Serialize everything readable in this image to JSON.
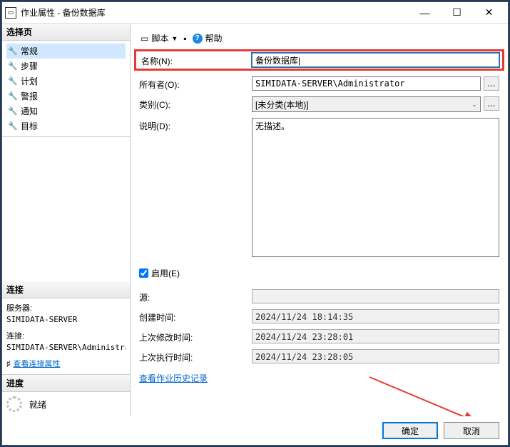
{
  "window": {
    "title": "作业属性 - 备份数据库"
  },
  "sidebar": {
    "select_header": "选择页",
    "items": [
      {
        "label": "常规"
      },
      {
        "label": "步骤"
      },
      {
        "label": "计划"
      },
      {
        "label": "警报"
      },
      {
        "label": "通知"
      },
      {
        "label": "目标"
      }
    ],
    "connection_header": "连接",
    "server_label": "服务器:",
    "server_value": "SIMIDATA-SERVER",
    "conn_label": "连接:",
    "conn_value": "SIMIDATA-SERVER\\Administrat",
    "view_conn_link": "查看连接属性",
    "progress_header": "进度",
    "progress_status": "就绪"
  },
  "toolbar": {
    "script_label": "脚本",
    "help_label": "帮助"
  },
  "form": {
    "name_label": "名称(N):",
    "name_value": "备份数据库|",
    "owner_label": "所有者(O):",
    "owner_value": "SIMIDATA-SERVER\\Administrator",
    "category_label": "类别(C):",
    "category_value": "[未分类(本地)]",
    "desc_label": "说明(D):",
    "desc_value": "无描述。",
    "enabled_label": "启用(E)",
    "source_label": "源:",
    "source_value": "",
    "created_label": "创建时间:",
    "created_value": "2024/11/24 18:14:35",
    "modified_label": "上次修改时间:",
    "modified_value": "2024/11/24 23:28:01",
    "executed_label": "上次执行时间:",
    "executed_value": "2024/11/24 23:28:05",
    "history_link": "查看作业历史记录"
  },
  "buttons": {
    "ok": "确定",
    "cancel": "取消"
  }
}
